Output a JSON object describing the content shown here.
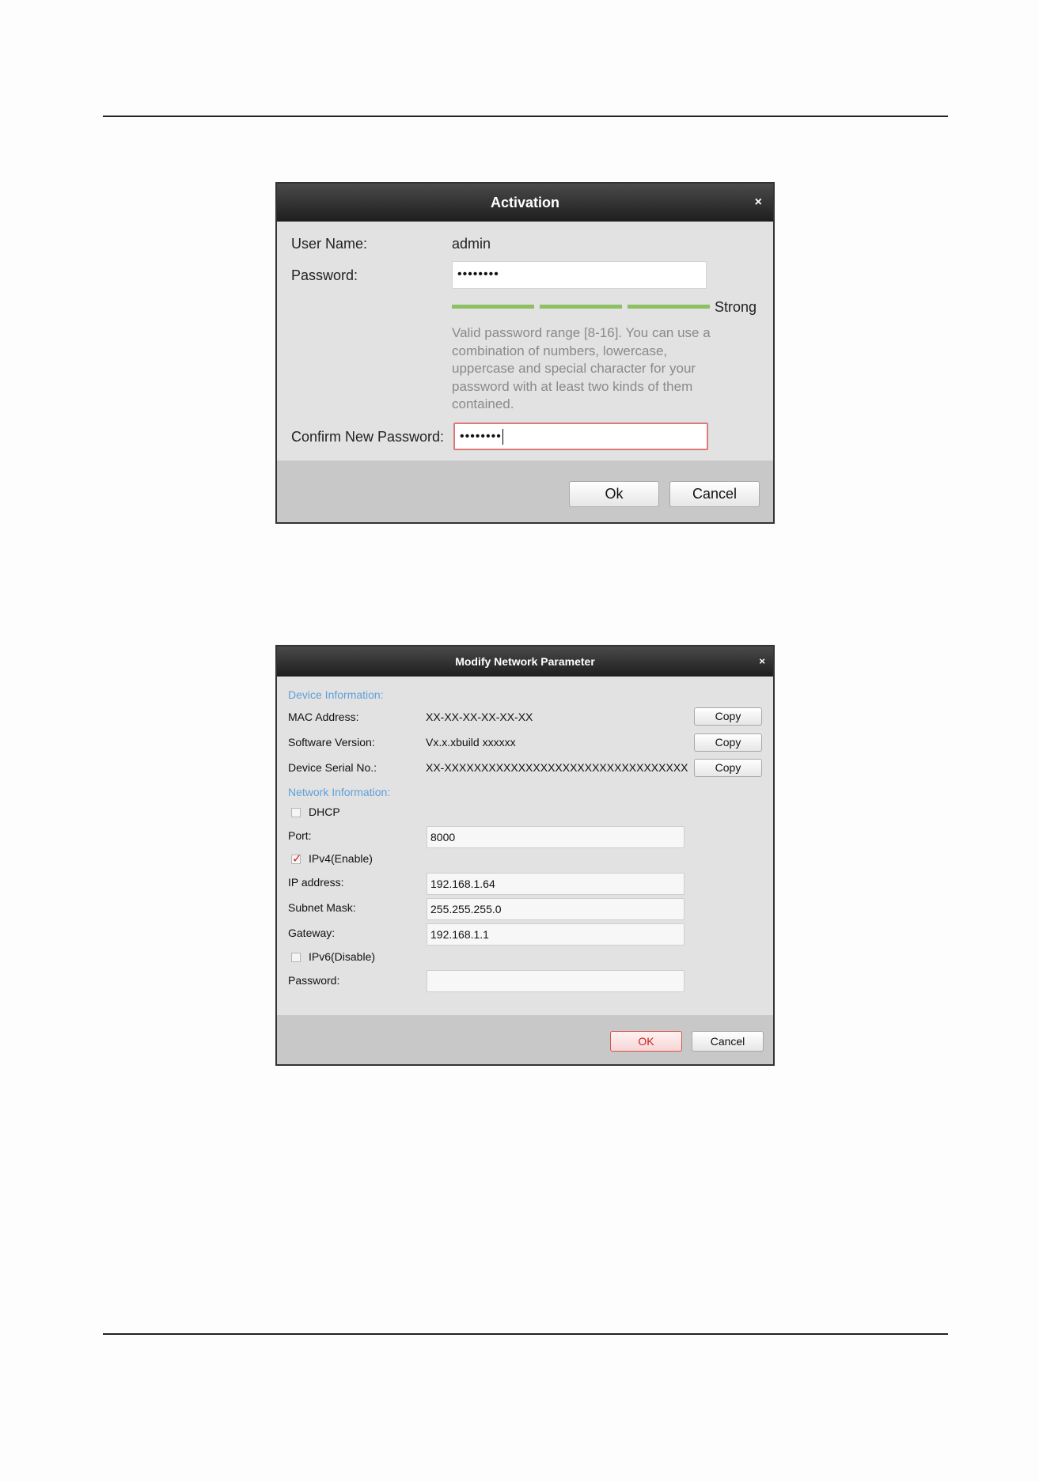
{
  "activation": {
    "title": "Activation",
    "close_glyph": "×",
    "user_name_label": "User Name:",
    "user_name_value": "admin",
    "password_label": "Password:",
    "password_value": "••••••••",
    "strength_label": "Strong",
    "strength_color": "#8cc063",
    "hint": "Valid password range [8-16]. You can use a combination of numbers, lowercase, uppercase and special character for your password with at least two kinds of them contained.",
    "confirm_label": "Confirm New Password:",
    "confirm_value": "••••••••",
    "ok_label": "Ok",
    "cancel_label": "Cancel"
  },
  "network": {
    "title": "Modify Network Parameter",
    "close_glyph": "×",
    "device_info_heading": "Device Information:",
    "mac_label": "MAC Address:",
    "mac_value": "XX-XX-XX-XX-XX-XX",
    "software_label": "Software Version:",
    "software_value": "Vx.x.xbuild xxxxxx",
    "serial_label": "Device Serial No.:",
    "serial_value": "XX-XXXXXXXXXXXXXXXXXXXXXXXXXXXXXXXXX",
    "copy_label": "Copy",
    "network_info_heading": "Network Information:",
    "dhcp_label": "DHCP",
    "dhcp_checked": false,
    "port_label": "Port:",
    "port_value": "8000",
    "ipv4_label": "IPv4(Enable)",
    "ipv4_checked": true,
    "ip_label": "IP address:",
    "ip_value": "192.168.1.64",
    "subnet_label": "Subnet Mask:",
    "subnet_value": "255.255.255.0",
    "gateway_label": "Gateway:",
    "gateway_value": "192.168.1.1",
    "ipv6_label": "IPv6(Disable)",
    "ipv6_checked": false,
    "password_label": "Password:",
    "password_value": "",
    "ok_label": "OK",
    "cancel_label": "Cancel",
    "accent_color": "#5fa0d8",
    "ok_border_color": "#d9534f"
  }
}
